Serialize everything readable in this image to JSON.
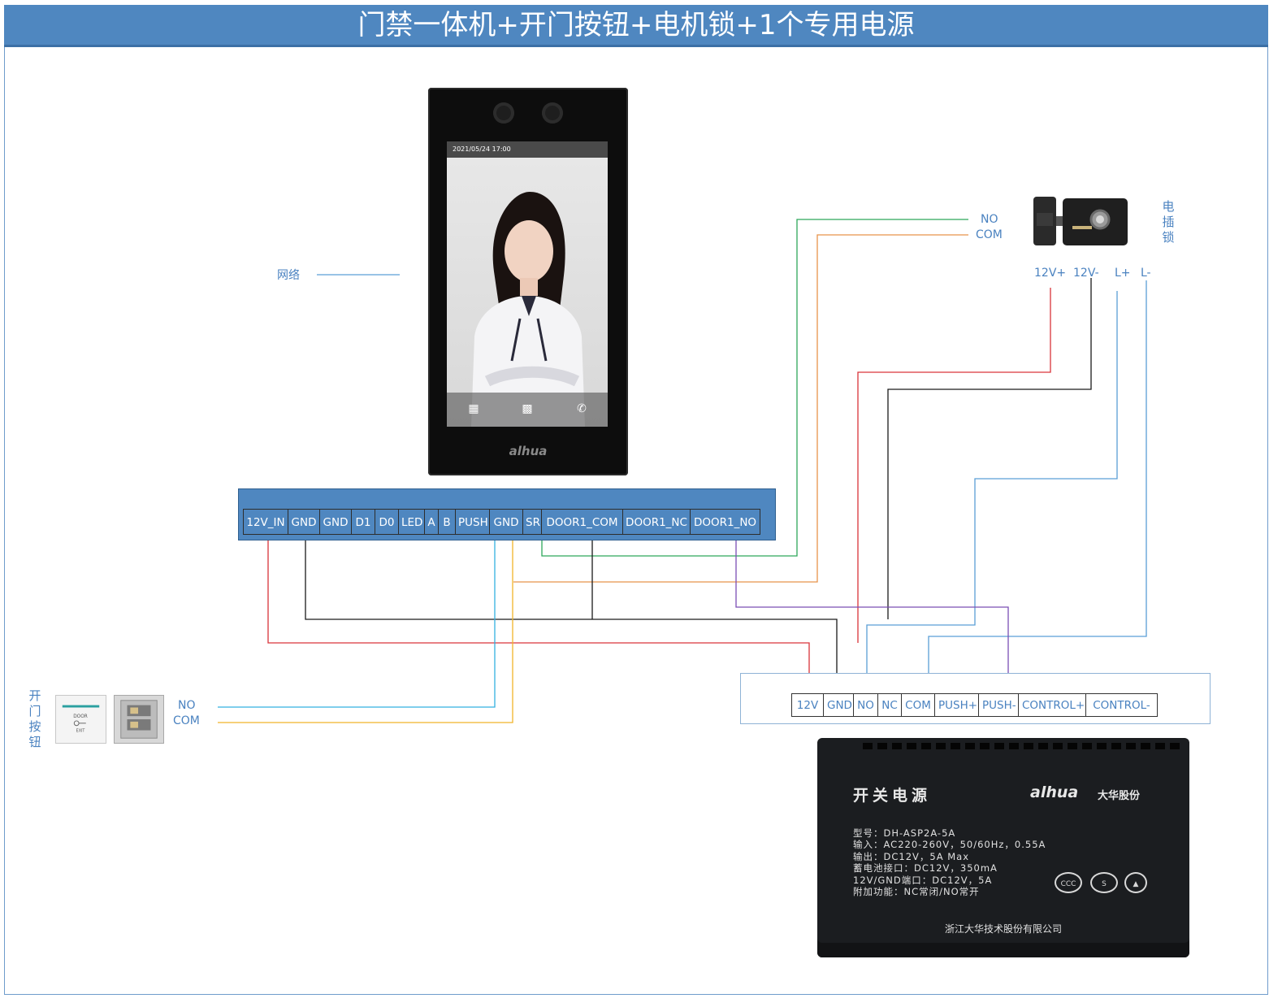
{
  "title": "门禁一体机+开门按钮+电机锁+1个专用电源",
  "labels": {
    "network": "网络",
    "lock_label": "电插锁",
    "lock_label_chars": [
      "电",
      "插",
      "锁"
    ],
    "button_label_chars": [
      "开",
      "门",
      "按",
      "钮"
    ],
    "lock_no": "NO",
    "lock_com": "COM",
    "button_no": "NO",
    "button_com": "COM",
    "lock_terms": [
      "12V+",
      "12V-",
      "L+",
      "L-"
    ]
  },
  "device": {
    "datetime": "2021/05/24  17:00",
    "brand": "alhua"
  },
  "device_terminals": [
    "12V_IN",
    "GND",
    "GND",
    "D1",
    "D0",
    "LED",
    "A",
    "B",
    "PUSH",
    "GND",
    "SR",
    "DOOR1_COM",
    "DOOR1_NC",
    "DOOR1_NO"
  ],
  "power_terminals": [
    "12V",
    "GND",
    "NO",
    "NC",
    "COM",
    "PUSH+",
    "PUSH-",
    "CONTROL+",
    "CONTROL-"
  ],
  "psu": {
    "title": "开关电源",
    "brand": "alhua",
    "brand_cn": "大华股份",
    "specs": [
      "型号：DH-ASP2A-5A",
      "输入：AC220-260V，50/60Hz，0.55A",
      "输出：DC12V，5A Max",
      "蓄电池接口：DC12V，350mA",
      "12V/GND端口：DC12V，5A",
      "附加功能：NC常闭/NO常开"
    ],
    "company": "浙江大华技术股份有限公司"
  },
  "colors": {
    "title_bg": "#4f87c0",
    "label": "#4a82c0",
    "wire_red": "#d9343a",
    "wire_black": "#1a1a1a",
    "wire_green": "#2ea85a",
    "wire_orange": "#e8934a",
    "wire_blue": "#5a9fd6",
    "wire_cyan": "#33b0e0",
    "wire_yellow": "#f0b429",
    "wire_purple": "#7b4fb5"
  }
}
